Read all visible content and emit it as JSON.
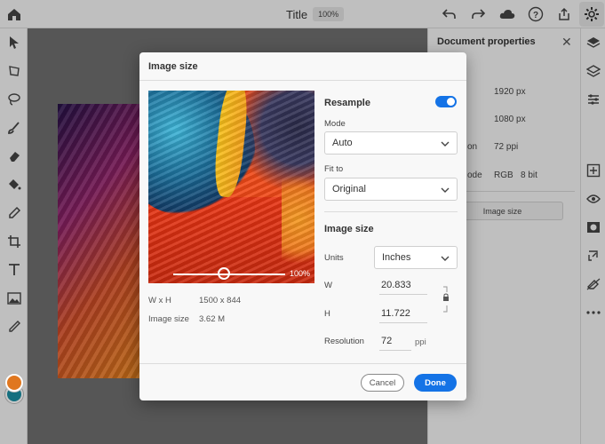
{
  "app": {
    "title": "Title",
    "zoom": "100%"
  },
  "right_panel": {
    "title": "Document properties",
    "width_value": "1920 px",
    "height_value": "1080 px",
    "resolution_label_partial": "on",
    "resolution_value": "72 ppi",
    "mode_label_partial": "ode",
    "mode_value": "RGB",
    "bit_value": "8 bit",
    "image_size_button": "Image size"
  },
  "dialog": {
    "title": "Image size",
    "preview": {
      "zoom": "100%"
    },
    "info": {
      "wh_label": "W x H",
      "wh_value": "1500 x 844",
      "size_label": "Image size",
      "size_value": "3.62 M"
    },
    "resample": {
      "heading": "Resample",
      "enabled": true,
      "mode_label": "Mode",
      "mode_value": "Auto",
      "fit_label": "Fit to",
      "fit_value": "Original"
    },
    "image_size": {
      "heading": "Image size",
      "units_label": "Units",
      "units_value": "Inches",
      "w_label": "W",
      "w_value": "20.833",
      "h_label": "H",
      "h_value": "11.722",
      "resolution_label": "Resolution",
      "resolution_value": "72",
      "resolution_unit": "ppi"
    },
    "buttons": {
      "cancel": "Cancel",
      "done": "Done"
    }
  },
  "colors": {
    "accent": "#1473e6",
    "foreground_swatch": "#e0771f",
    "background_swatch": "#1a8fa3"
  }
}
